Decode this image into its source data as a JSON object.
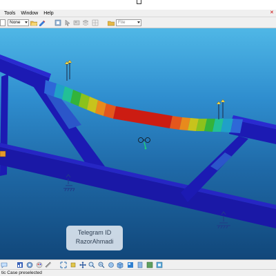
{
  "menubar": {
    "items": [
      {
        "label": "Tools",
        "mnemonic": "T"
      },
      {
        "label": "Window",
        "mnemonic": "W"
      },
      {
        "label": "Help",
        "mnemonic": "H"
      }
    ]
  },
  "toolbar": {
    "combo1_value": "",
    "combo2_value": "None",
    "file_combo_value": "File"
  },
  "viewport": {
    "analysis_result": "deformed-beam-displacement-contour",
    "colors": {
      "frame": "#1c1ab3",
      "frame_dark": "#0f0f84",
      "contour_max": "#cc1c12",
      "contour_min": "#2e68d8"
    },
    "annotation": {
      "line1": "Telegram ID",
      "line2": "RazorAhmadi"
    }
  },
  "status": {
    "text": "tic Case preselected"
  },
  "icons": {
    "toolbar": [
      "open-folder-icon",
      "edit-icon",
      "render-style-icon",
      "select-icon",
      "image-icon",
      "layers-icon",
      "folder-icon"
    ],
    "bottom": [
      "chat-icon",
      "analysis-icon",
      "sensor-icon",
      "palette-icon",
      "measure-icon",
      "fit-all-icon",
      "pan-icon",
      "rotate-icon",
      "zoom-in-icon",
      "zoom-out-icon",
      "normal-view-icon",
      "view-cube-icon",
      "shading-icon",
      "hide-show-icon",
      "swap-visible-icon"
    ]
  }
}
